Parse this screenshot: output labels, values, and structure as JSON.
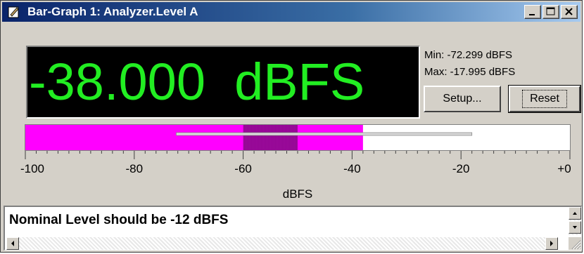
{
  "window": {
    "title": "Bar-Graph 1: Analyzer.Level A",
    "icons": [
      "app-icon",
      "minimize-icon",
      "maximize-icon",
      "close-icon"
    ]
  },
  "readout": {
    "value_text": "-38.000  dBFS",
    "color": "#22ee22",
    "background": "#000000"
  },
  "stats": {
    "min_text": "Min: -72.299  dBFS",
    "max_text": "Max: -17.995  dBFS"
  },
  "buttons": {
    "setup_label": "Setup...",
    "reset_label": "Reset"
  },
  "bar": {
    "range": [
      -100,
      0
    ],
    "level": -38.0,
    "min": -72.299,
    "max": -17.995,
    "highlight_start": -60,
    "highlight_end": -50,
    "bar_color": "#ff00ff",
    "highlight_color": "#880088"
  },
  "scale": {
    "tick_labels": [
      "-100",
      "-80",
      "-60",
      "-40",
      "-20",
      "+0"
    ],
    "axis_label": "dBFS"
  },
  "message": {
    "text": "Nominal Level should be -12 dBFS"
  }
}
